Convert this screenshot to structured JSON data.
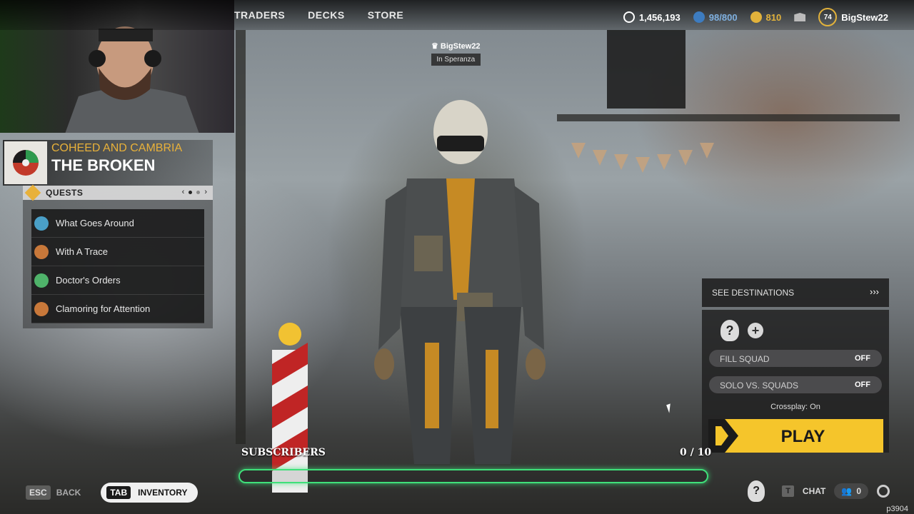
{
  "nav": {
    "items": [
      "TRADERS",
      "DECKS",
      "STORE"
    ]
  },
  "currency": {
    "raider_coins": "1,456,193",
    "blue_slots": "98/800",
    "gold": "810"
  },
  "player": {
    "level": "74",
    "name": "BigStew22"
  },
  "overhead": {
    "name": "BigStew22",
    "location": "In Speranza"
  },
  "song": {
    "artist": "COHEED AND CAMBRIA",
    "title": "THE BROKEN"
  },
  "quests": {
    "header": "QUESTS",
    "items": [
      {
        "label": "What Goes Around",
        "color": "#4aa0c8"
      },
      {
        "label": "With A Trace",
        "color": "#c8783a"
      },
      {
        "label": "Doctor's Orders",
        "color": "#4fb36a"
      },
      {
        "label": "Clamoring for Attention",
        "color": "#c8783a"
      }
    ]
  },
  "panel": {
    "destinations": "SEE DESTINATIONS",
    "fill_squad_label": "FILL SQUAD",
    "fill_squad_value": "OFF",
    "solo_label": "SOLO VS. SQUADS",
    "solo_value": "OFF",
    "crossplay": "Crossplay: On",
    "play": "PLAY"
  },
  "subscribers": {
    "label": "SUBSCRIBERS",
    "count": "0 / 10",
    "progress": 0.0
  },
  "bottom": {
    "esc_key": "ESC",
    "back": "BACK",
    "tab_key": "TAB",
    "inventory": "INVENTORY",
    "chat_key": "T",
    "chat": "CHAT",
    "friends_count": "0",
    "build": "p3904"
  },
  "colors": {
    "accent_yellow": "#f5c52b",
    "progress_green": "#3fe07a"
  }
}
